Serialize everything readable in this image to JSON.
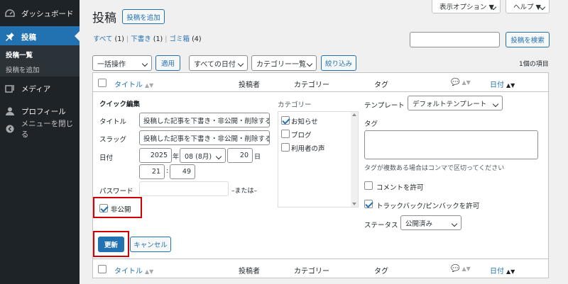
{
  "sidebar": {
    "items": [
      {
        "label": "ダッシュボード",
        "icon": "dashboard-icon"
      },
      {
        "label": "投稿",
        "icon": "pin-icon"
      },
      {
        "label": "メディア",
        "icon": "media-icon"
      },
      {
        "label": "プロフィール",
        "icon": "user-icon"
      },
      {
        "label": "メニューを閉じる",
        "icon": "collapse-icon"
      }
    ],
    "submenu": [
      "投稿一覧",
      "投稿を追加"
    ]
  },
  "header": {
    "title": "投稿",
    "add_new": "投稿を追加",
    "screen_options": "表示オプション ▼",
    "help": "ヘルプ ▼"
  },
  "filters": {
    "all": "すべて",
    "all_count": "(1)",
    "drafts": "下書き",
    "drafts_count": "(1)",
    "trash": "ゴミ箱",
    "trash_count": "(4)",
    "sep": "|"
  },
  "search": {
    "value": "",
    "button": "投稿を検索"
  },
  "toolbar": {
    "bulk": "一括操作",
    "apply": "適用",
    "dates": "すべての日付",
    "category": "カテゴリー一覧",
    "filter": "絞り込み",
    "count": "1個の項目"
  },
  "columns": {
    "title": "タイトル",
    "author": "投稿者",
    "categories": "カテゴリー",
    "tags": "タグ",
    "date": "日付"
  },
  "quick_edit": {
    "heading": "クイック編集",
    "title_label": "タイトル",
    "title_value": "投稿した記事を下書き・非公開・削除する",
    "slug_label": "スラッグ",
    "slug_value": "投稿した記事を下書き・非公開・削除する",
    "date_label": "日付",
    "year": "2025",
    "year_suffix": "年",
    "month": "08 (8月)",
    "day": "20",
    "day_suffix": "日",
    "hour": "21",
    "colon": ":",
    "minute": "49",
    "password_label": "パスワード",
    "password_value": "",
    "or": "–または–",
    "private_label": "非公開",
    "categories_label": "カテゴリー",
    "categories": [
      {
        "label": "お知らせ",
        "checked": true
      },
      {
        "label": "ブログ",
        "checked": false
      },
      {
        "label": "利用者の声",
        "checked": false
      }
    ],
    "template_label": "テンプレート",
    "template_value": "デフォルトテンプレート",
    "tags_label": "タグ",
    "tags_value": "",
    "tags_hint": "タグが複数ある場合はコンマで区切ってください",
    "allow_comments": "コメントを許可",
    "allow_pings": "トラックバック/ピンバックを許可",
    "status_label": "ステータス",
    "status_value": "公開済み",
    "update": "更新",
    "cancel": "キャンセル"
  },
  "colors": {
    "accent": "#2271b1",
    "sidebar": "#1d2327",
    "highlight": "#d40000"
  }
}
